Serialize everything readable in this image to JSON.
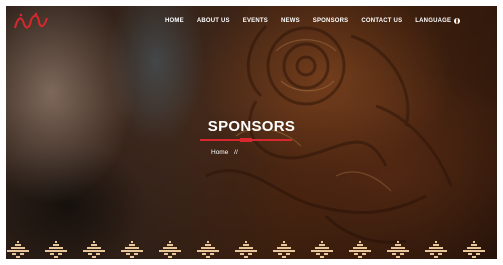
{
  "header": {
    "logo_name": "brand-logo",
    "nav": [
      {
        "label": "HOME"
      },
      {
        "label": "ABOUT US"
      },
      {
        "label": "EVENTS"
      },
      {
        "label": "NEWS"
      },
      {
        "label": "SPONSORS"
      },
      {
        "label": "CONTACT US"
      }
    ],
    "language_label": "LANGUAGE"
  },
  "hero": {
    "title": "SPONSORS",
    "breadcrumb_home": "Home",
    "breadcrumb_sep": "//"
  },
  "colors": {
    "accent": "#d6282e",
    "text": "#ffffff",
    "leather": "#7a3f1c",
    "pattern": "#e8c69a"
  }
}
